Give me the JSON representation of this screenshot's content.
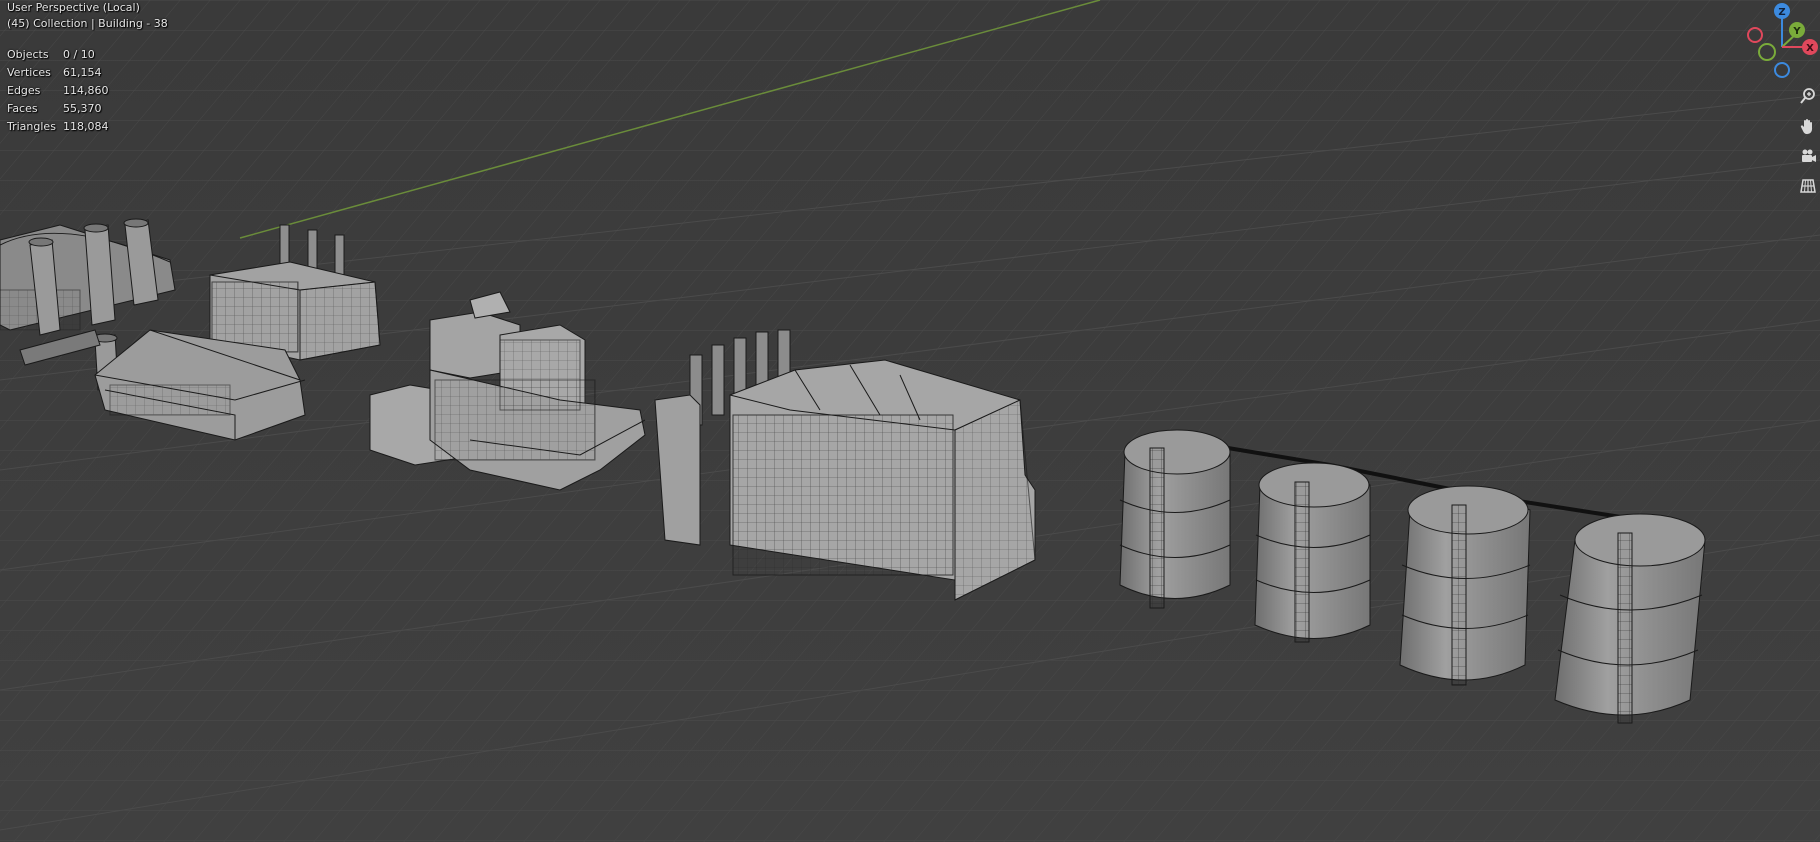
{
  "viewport": {
    "title": "User Perspective (Local)",
    "collection": "(45) Collection | Building - 38"
  },
  "stats": [
    {
      "label": "Objects",
      "value": "0 / 10"
    },
    {
      "label": "Vertices",
      "value": "61,154"
    },
    {
      "label": "Edges",
      "value": "114,860"
    },
    {
      "label": "Faces",
      "value": "55,370"
    },
    {
      "label": "Triangles",
      "value": "118,084"
    }
  ],
  "gizmo": {
    "z_label": "Z",
    "y_label": "Y",
    "x_label": "X",
    "colors": {
      "x": "#e0485c",
      "y": "#7aab3a",
      "z": "#3c8adf"
    }
  },
  "nav_tools": [
    "zoom-icon",
    "pan-hand-icon",
    "camera-icon",
    "grid-view-icon"
  ],
  "colors": {
    "background": "#3d3d3d",
    "grid": "#4a4a4a",
    "green_axis": "#6a8c3a",
    "mesh_fill": "#8c8c8c",
    "wire": "#1a1a1a"
  }
}
